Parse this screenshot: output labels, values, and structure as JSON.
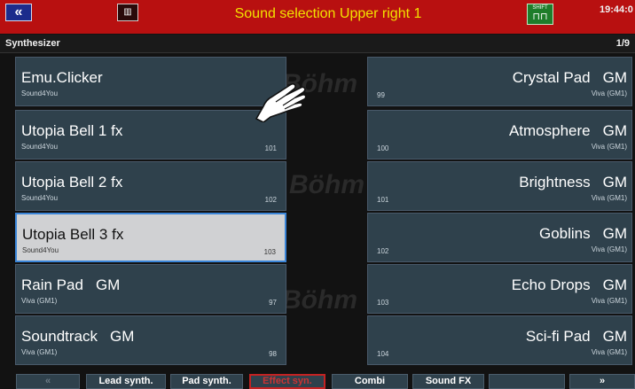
{
  "top_bar": {
    "back_label": "«",
    "mode_label": "▥",
    "title": "Sound selection Upper right 1",
    "shift_label": "SHIFT",
    "clock": "19:44:0"
  },
  "header": {
    "category": "Synthesizer",
    "page": "1/9"
  },
  "background_logo": "Böhm",
  "left_sounds": [
    {
      "name": "Emu.Clicker",
      "gm": "",
      "maker": "Sound4You",
      "number": "",
      "selected": false
    },
    {
      "name": "Utopia Bell 1 fx",
      "gm": "",
      "maker": "Sound4You",
      "number": "101",
      "selected": false
    },
    {
      "name": "Utopia Bell 2 fx",
      "gm": "",
      "maker": "Sound4You",
      "number": "102",
      "selected": false
    },
    {
      "name": "Utopia Bell 3 fx",
      "gm": "",
      "maker": "Sound4You",
      "number": "103",
      "selected": true
    },
    {
      "name": "Rain Pad",
      "gm": "GM",
      "maker": "Viva (GM1)",
      "number": "97",
      "selected": false
    },
    {
      "name": "Soundtrack",
      "gm": "GM",
      "maker": "Viva (GM1)",
      "number": "98",
      "selected": false
    }
  ],
  "right_sounds": [
    {
      "name": "Crystal Pad",
      "gm": "GM",
      "maker": "Viva (GM1)",
      "number": "99"
    },
    {
      "name": "Atmosphere",
      "gm": "GM",
      "maker": "Viva (GM1)",
      "number": "100"
    },
    {
      "name": "Brightness",
      "gm": "GM",
      "maker": "Viva (GM1)",
      "number": "101"
    },
    {
      "name": "Goblins",
      "gm": "GM",
      "maker": "Viva (GM1)",
      "number": "102"
    },
    {
      "name": "Echo Drops",
      "gm": "GM",
      "maker": "Viva (GM1)",
      "number": "103"
    },
    {
      "name": "Sci-fi Pad",
      "gm": "GM",
      "maker": "Viva (GM1)",
      "number": "104"
    }
  ],
  "tabs": {
    "prev": "«",
    "lead": "Lead synth.",
    "pad": "Pad synth.",
    "effect": "Effect syn.",
    "combi": "Combi",
    "soundfx": "Sound FX",
    "empty": "",
    "next": "»"
  },
  "colors": {
    "top_bar": "#b81010",
    "title": "#f2e200",
    "slot": "#2f414c",
    "selected_slot": "#d0d1d3",
    "selected_border": "#3a85d8",
    "active_tab": "#c42222"
  }
}
